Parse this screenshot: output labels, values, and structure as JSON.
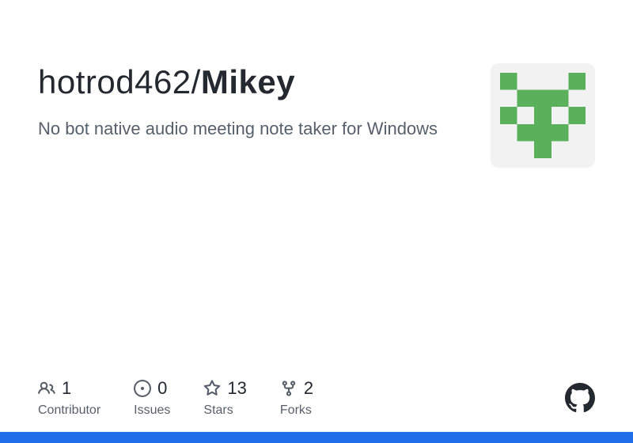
{
  "repo": {
    "owner": "hotrod462",
    "separator": "/",
    "name": "Mikey",
    "description": "No bot native audio meeting note taker for Windows"
  },
  "stats": {
    "contributors": {
      "value": "1",
      "label": "Contributor"
    },
    "issues": {
      "value": "0",
      "label": "Issues"
    },
    "stars": {
      "value": "13",
      "label": "Stars"
    },
    "forks": {
      "value": "2",
      "label": "Forks"
    }
  }
}
